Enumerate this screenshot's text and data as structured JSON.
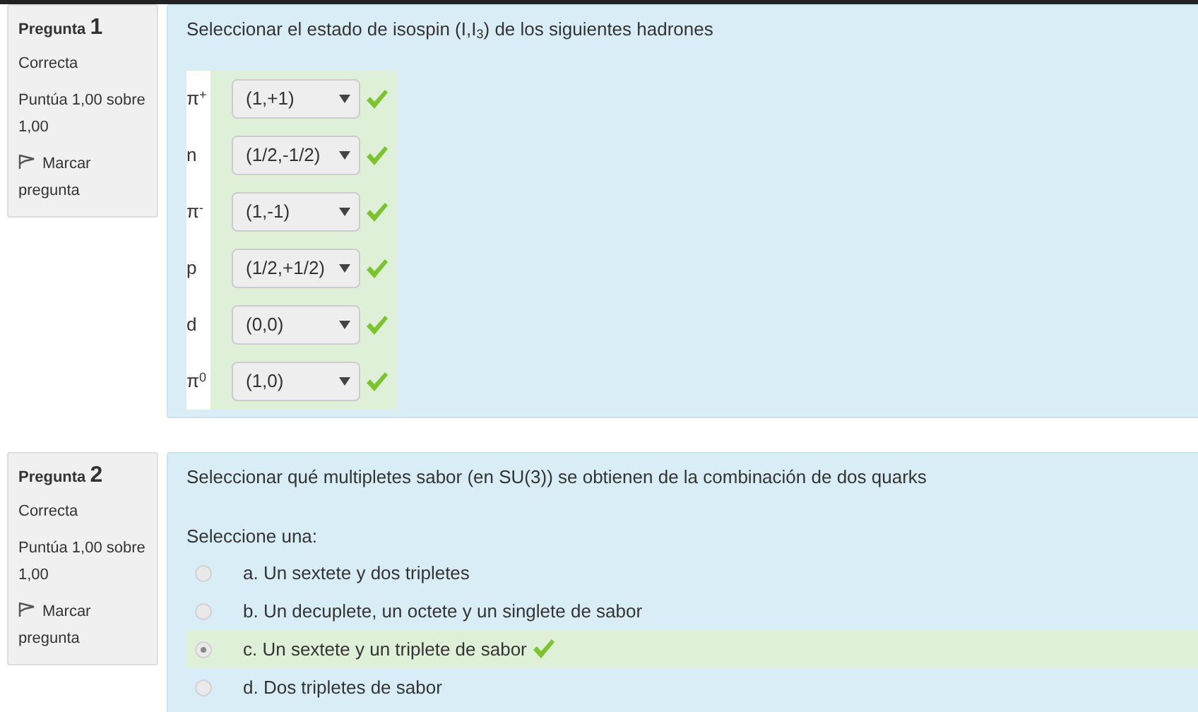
{
  "questions": [
    {
      "label": "Pregunta",
      "number": "1",
      "status": "Correcta",
      "grade": "Puntúa 1,00 sobre 1,00",
      "flag": "Marcar pregunta",
      "kind": "matching",
      "text": "Seleccionar el estado de isospin (I,I$_{3}$) de los siguientes hadrones",
      "rows": [
        {
          "label": "π$^{+}$",
          "answer": "(1,+1)",
          "correct": true
        },
        {
          "label": "n",
          "answer": "(1/2,-1/2)",
          "correct": true
        },
        {
          "label": "π$^{-}$",
          "answer": "(1,-1)",
          "correct": true
        },
        {
          "label": "p",
          "answer": "(1/2,+1/2)",
          "correct": true
        },
        {
          "label": "d",
          "answer": "(0,0)",
          "correct": true
        },
        {
          "label": "π$^{0}$",
          "answer": "(1,0)",
          "correct": true
        }
      ]
    },
    {
      "label": "Pregunta",
      "number": "2",
      "status": "Correcta",
      "grade": "Puntúa 1,00 sobre 1,00",
      "flag": "Marcar pregunta",
      "kind": "multichoice",
      "text": "Seleccionar qué multipletes sabor (en SU(3)) se obtienen de la combinación de dos quarks",
      "prompt": "Seleccione una:",
      "options": [
        {
          "label": "a. Un sextete y dos tripletes",
          "selected": false,
          "correct": false
        },
        {
          "label": "b. Un decuplete, un octete y un singlete de sabor",
          "selected": false,
          "correct": false
        },
        {
          "label": "c. Un sextete y un triplete de sabor",
          "selected": true,
          "correct": true
        },
        {
          "label": "d. Dos tripletes de sabor",
          "selected": false,
          "correct": false
        }
      ]
    }
  ]
}
